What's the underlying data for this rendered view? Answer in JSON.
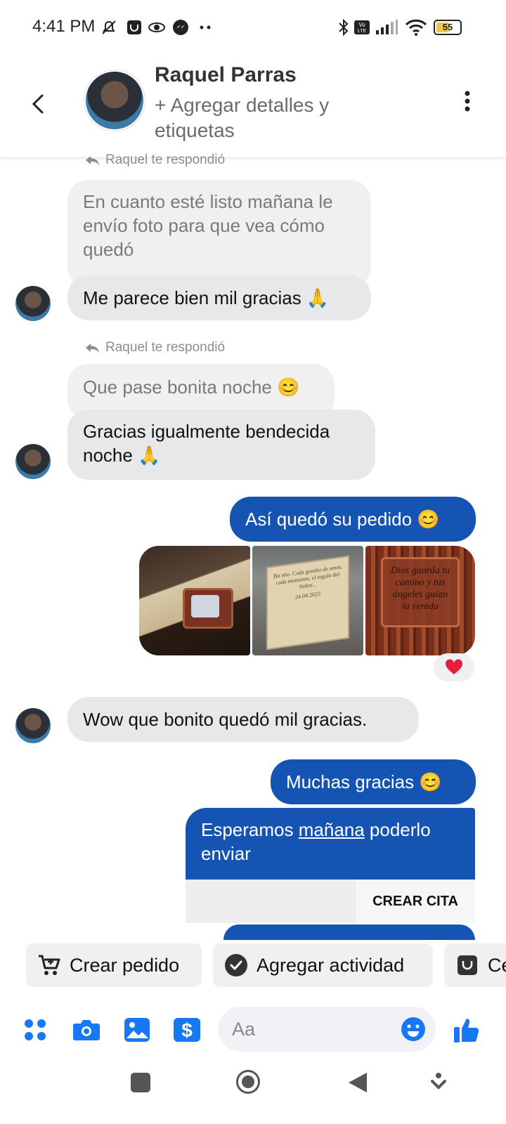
{
  "status_bar": {
    "time": "4:41 PM",
    "battery": "55"
  },
  "header": {
    "name": "Raquel Parras",
    "subtitle": "+ Agregar detalles y etiquetas"
  },
  "messages": {
    "reply_note_1": "Raquel te respondió",
    "quoted_1": "En cuanto esté listo mañana le envío foto para que vea cómo quedó",
    "reply_1": "Me parece bien mil gracias 🙏",
    "reply_note_2": "Raquel te respondió",
    "quoted_2": "Que pase bonita noche 😊",
    "reply_2": "Gracias igualmente bendecida noche 🙏",
    "out_1": "Así quedó su pedido 😊",
    "photo_2_text": "Bu sito. Cada granito de amor, cada momento, el regalo del Señor...",
    "photo_2_date": "24.04.2023",
    "photo_3_text": "Dios guarda tu camino y tus ángeles guían la vereda",
    "in_3": "Wow que bonito quedó mil gracias.",
    "out_2": "Muchas gracias 😊",
    "out_3_before": "Esperamos ",
    "out_3_link": "mañana",
    "out_3_after": " poderlo enviar",
    "card_action": "CREAR CITA"
  },
  "chips": [
    {
      "label": "Crear pedido",
      "icon": "cart-icon"
    },
    {
      "label": "Agregar actividad",
      "icon": "check-circle-icon"
    },
    {
      "label": "Ce",
      "icon": "bag-icon"
    }
  ],
  "composer": {
    "placeholder": "Aa"
  },
  "colors": {
    "accent": "#1554b3",
    "icon_blue": "#1877f2",
    "bubble_in": "#e7e8ea",
    "heart": "#e41e3f"
  }
}
